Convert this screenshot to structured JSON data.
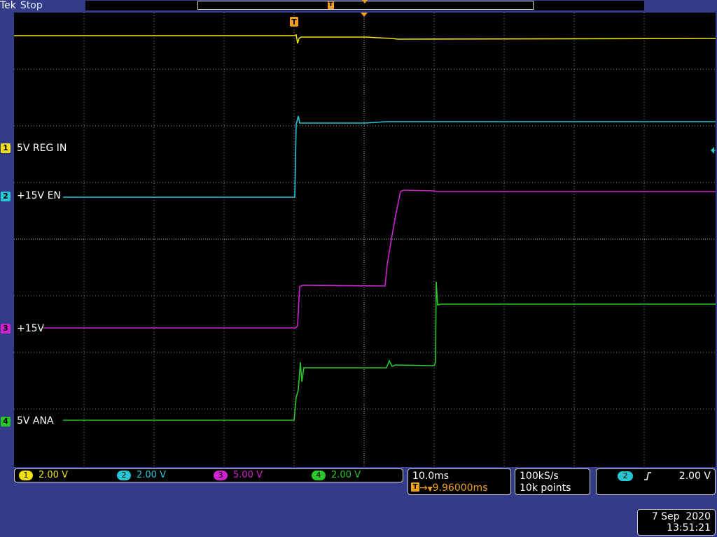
{
  "header": {
    "brand": "Tek",
    "status": "Stop",
    "trigger_glyph": "T"
  },
  "channels": [
    {
      "id": "1",
      "label": "5V REG IN",
      "scale": "2.00 V",
      "color": "#f0e010"
    },
    {
      "id": "2",
      "label": "+15V EN",
      "scale": "2.00 V",
      "color": "#27c4d2"
    },
    {
      "id": "3",
      "label": "+15V",
      "scale": "5.00 V",
      "color": "#cf22cf"
    },
    {
      "id": "4",
      "label": "5V ANA",
      "scale": "2.00 V",
      "color": "#29c729"
    }
  ],
  "timebase": {
    "time_per_div": "10.0ms",
    "trigger_delay": "9.96000ms"
  },
  "acquisition": {
    "sample_rate": "100kS/s",
    "record_length": "10k points"
  },
  "trigger": {
    "source": "2",
    "slope_icon": "rising-edge-icon",
    "level": "2.00 V"
  },
  "datetime": {
    "date": "7 Sep  2020",
    "time": "13:51:21"
  },
  "colors": {
    "background": "#343c8a",
    "screen": "#000000",
    "trigger_orange": "#f0a020",
    "grid": "#8c8c8c"
  }
}
